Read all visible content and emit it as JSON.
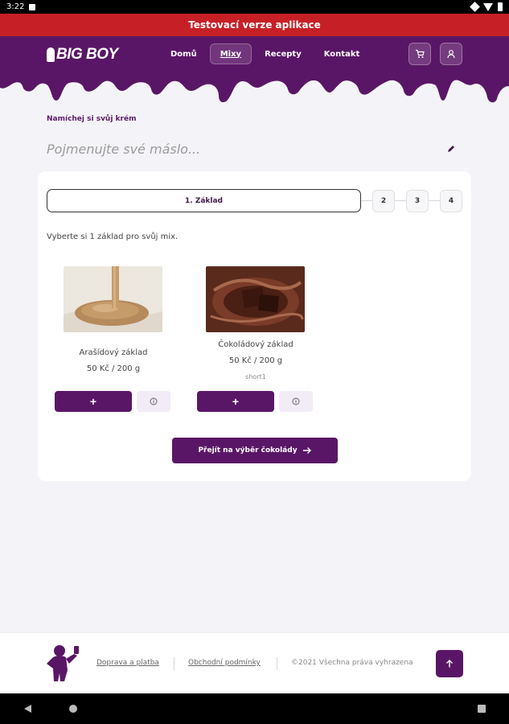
{
  "status_bar": {
    "time": "3:22"
  },
  "banner": {
    "text": "Testovací verze aplikace"
  },
  "header": {
    "logo_text": "BIG BOY",
    "nav": [
      {
        "label": "Domů",
        "active": false
      },
      {
        "label": "Mixy",
        "active": true
      },
      {
        "label": "Recepty",
        "active": false
      },
      {
        "label": "Kontakt",
        "active": false
      }
    ],
    "cart_icon": "cart-icon",
    "user_icon": "user-icon"
  },
  "page": {
    "subtitle": "Namíchej si svůj krém",
    "name_placeholder": "Pojmenujte své máslo...",
    "name_value": "",
    "edit_icon": "pencil-icon"
  },
  "steps": {
    "active_label": "1. Základ",
    "others": [
      "2",
      "3",
      "4"
    ]
  },
  "instruction": "Vyberte si 1 základ pro svůj mix.",
  "products": [
    {
      "name": "Arašídový základ",
      "price": "50 Kč / 200 g",
      "short": "",
      "add_label": "+",
      "info_icon": "info-icon"
    },
    {
      "name": "Čokoládový základ",
      "price": "50 Kč / 200 g",
      "short": "short1",
      "add_label": "+",
      "info_icon": "info-icon"
    }
  ],
  "next_button": {
    "label": "Přejít na výběr čokolády",
    "icon": "arrow-right-icon"
  },
  "footer": {
    "links": [
      "Doprava a platba",
      "Obchodní podmínky"
    ],
    "copyright": "©2021 Všechna práva vyhrazena",
    "up_icon": "arrow-up-icon"
  },
  "colors": {
    "brand_purple": "#5a1666",
    "banner_red": "#c62026"
  }
}
